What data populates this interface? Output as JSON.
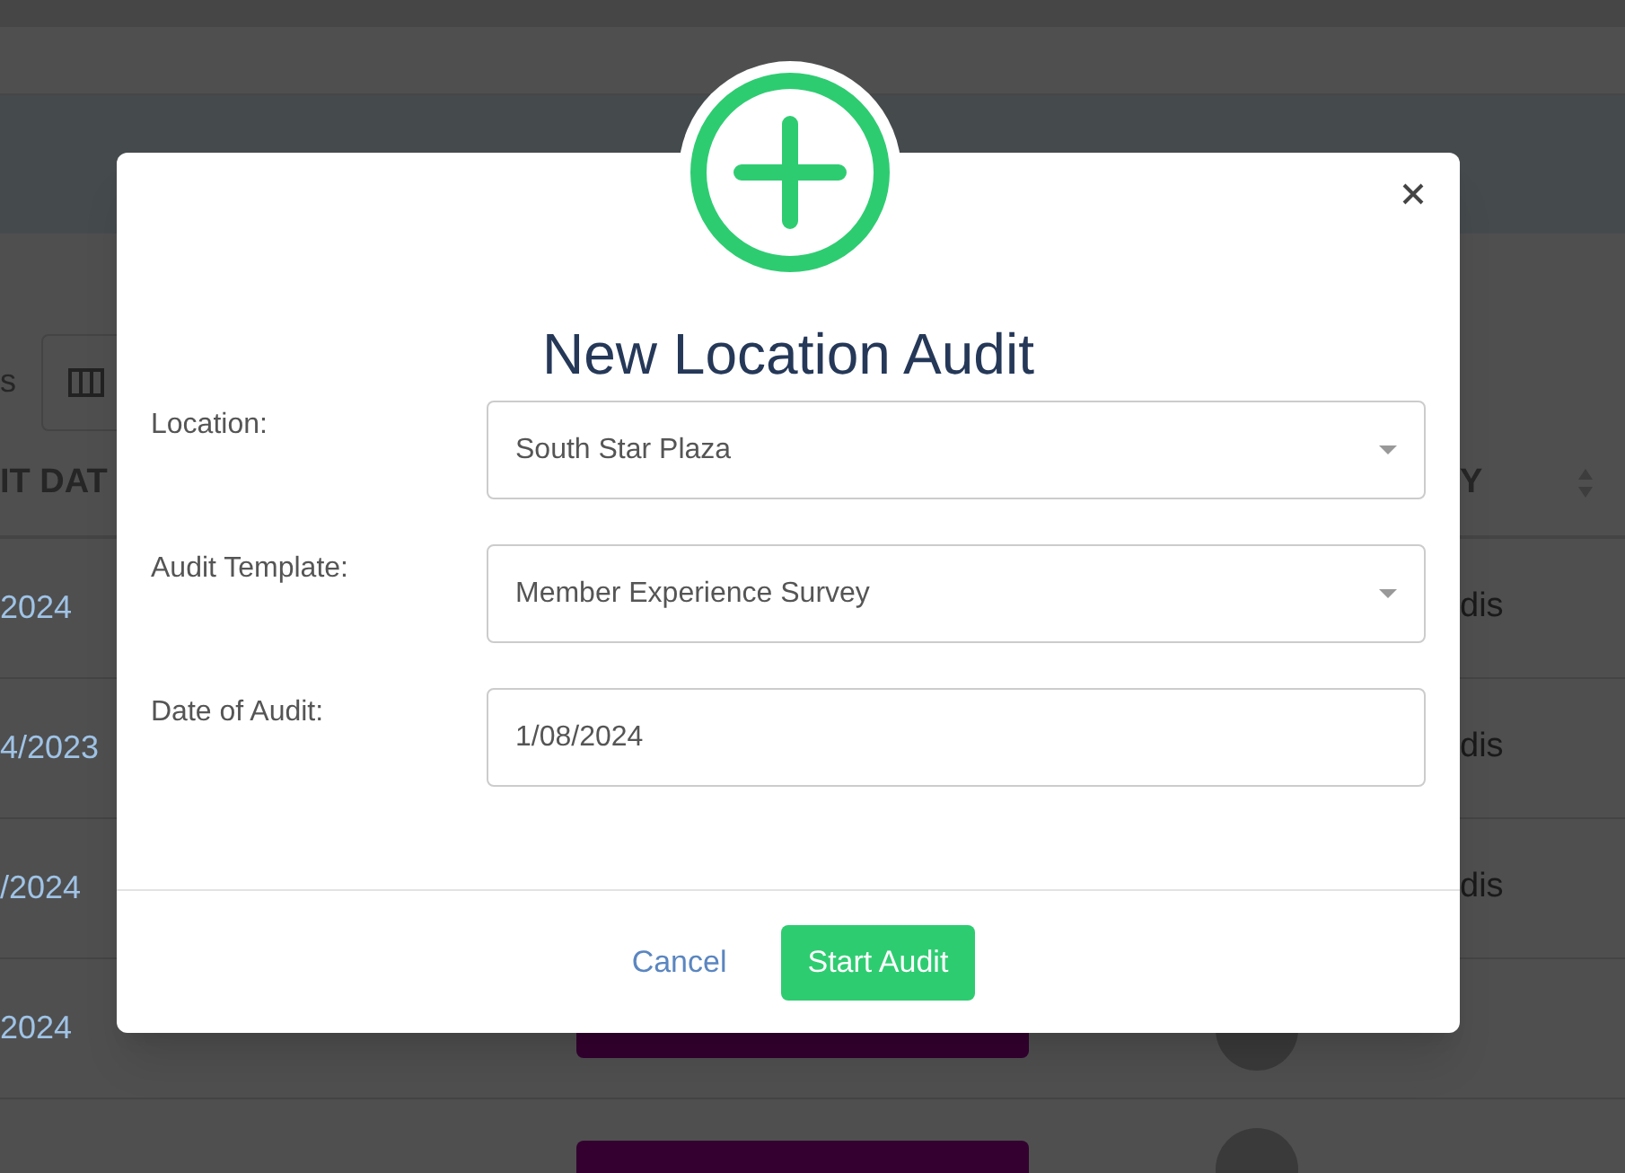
{
  "background": {
    "toolbar": {
      "label": "s"
    },
    "table": {
      "columns": [
        "IT DAT",
        "Y"
      ],
      "rows": [
        {
          "date": "2024",
          "reporter": "dis"
        },
        {
          "date": "4/2023",
          "reporter": "dis"
        },
        {
          "date": "/2024",
          "reporter": "dis"
        },
        {
          "kind": "covered",
          "date": "2024"
        },
        {
          "kind": "covered"
        }
      ]
    }
  },
  "modal": {
    "title": "New Location Audit",
    "fields": [
      {
        "kind": "select",
        "label": "Location:",
        "value": "South Star Plaza"
      },
      {
        "kind": "select",
        "label": "Audit Template:",
        "value": "Member Experience Survey"
      },
      {
        "kind": "date",
        "label": "Date of Audit:",
        "value": "1/08/2024"
      }
    ],
    "buttons": [
      {
        "kind": "link",
        "label": "Cancel"
      },
      {
        "kind": "primary",
        "label": "Start Audit"
      }
    ]
  }
}
